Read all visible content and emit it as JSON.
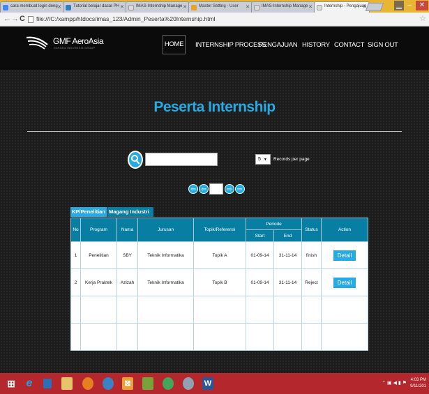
{
  "browser": {
    "tabs": [
      {
        "label": "cara membuat login deng",
        "fav_color": "#4285f4"
      },
      {
        "label": "Tutorial belajar dasar PH",
        "fav_color": "#2d7fc1"
      },
      {
        "label": "IMAS-Internship Manage",
        "fav_color": "#dddddd"
      },
      {
        "label": "Master Setting - User",
        "fav_color": "#e8a22a"
      },
      {
        "label": "IMAS-Internship Manage",
        "fav_color": "#dddddd"
      },
      {
        "label": "Internship - Pengajuan",
        "fav_color": "#dddddd"
      }
    ],
    "url": "file:///C:/xampp/htdocs/imas_123/Admin_Peserta%20Internship.html",
    "win_min": "▁",
    "win_max": "–",
    "win_close": "✕"
  },
  "site": {
    "logo_text": "GMF AeroAsia",
    "logo_sub": "GARUDA INDONESIA GROUP",
    "menu": [
      "HOME",
      "INTERNSHIP PROCESS",
      "PENGAJUAN",
      "HISTORY",
      "CONTACT",
      "SIGN OUT"
    ]
  },
  "page": {
    "title": "Peserta Internship",
    "search_value": "",
    "records_value": "5",
    "records_label": "Records per page",
    "tabs": [
      "KP/Penelitian",
      "Magang Industri"
    ],
    "table": {
      "headers": {
        "no": "No",
        "program": "Program",
        "nama": "Nama",
        "jurusan": "Jurusan",
        "topik": "Topik/Referensi",
        "periode": "Periode",
        "start": "Start",
        "end": "End",
        "status": "Status",
        "action": "Action"
      },
      "rows": [
        {
          "no": "1",
          "program": "Penelitian",
          "nama": "SBY",
          "jurusan": "Teknik Informatika",
          "topik": "Topik A",
          "start": "01-09-14",
          "end": "31-11-14",
          "status": "finish",
          "action": "Detail"
        },
        {
          "no": "2",
          "program": "Kerja Praktek",
          "nama": "Azizah",
          "jurusan": "Teknik Informatika",
          "topik": "Topik B",
          "start": "01-09-14",
          "end": "31-11-14",
          "status": "Reject",
          "action": "Detail"
        }
      ]
    }
  },
  "taskbar": {
    "time": "4:03 PM",
    "date": "9/11/201"
  },
  "colors": {
    "accent": "#27a9e1",
    "table_header": "#087fa2",
    "taskbar": "#b3272d",
    "tabbar": "#e8b632"
  }
}
